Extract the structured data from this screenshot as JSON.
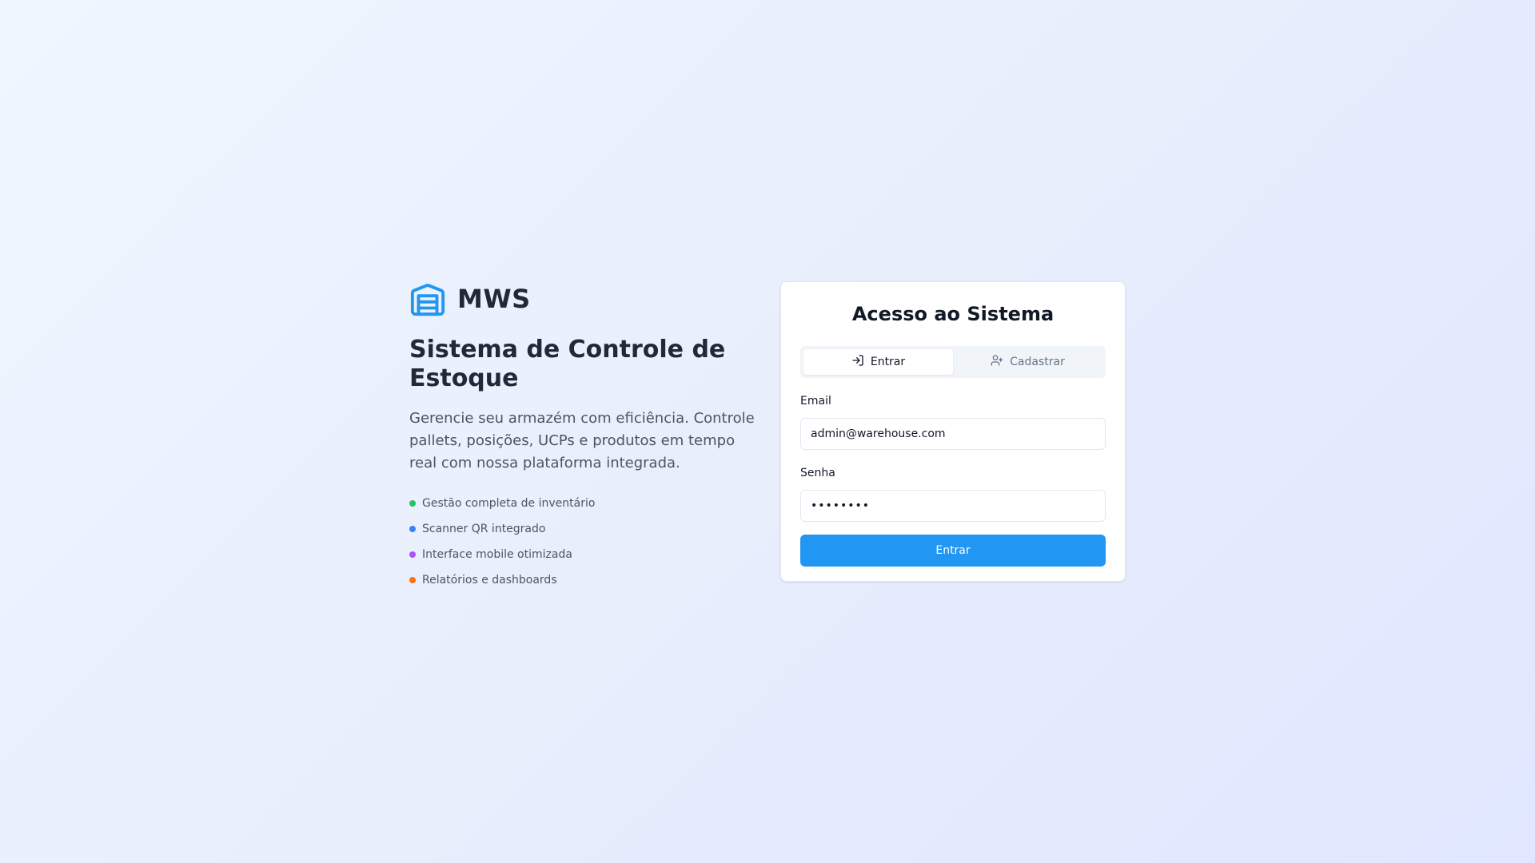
{
  "brand": {
    "name": "MWS",
    "logo_icon": "warehouse-icon",
    "accent_color": "#2196f3"
  },
  "hero": {
    "headline": "Sistema de Controle de Estoque",
    "description": "Gerencie seu armazém com eficiência. Controle pallets, posições, UCPs e produtos em tempo real com nossa plataforma integrada.",
    "features": [
      {
        "label": "Gestão completa de inventário",
        "color": "#22c55e"
      },
      {
        "label": "Scanner QR integrado",
        "color": "#3b82f6"
      },
      {
        "label": "Interface mobile otimizada",
        "color": "#a855f7"
      },
      {
        "label": "Relatórios e dashboards",
        "color": "#f97316"
      }
    ]
  },
  "login_card": {
    "title": "Acesso ao Sistema",
    "tabs": [
      {
        "label": "Entrar",
        "icon": "log-in-icon",
        "active": true
      },
      {
        "label": "Cadastrar",
        "icon": "user-plus-icon",
        "active": false
      }
    ],
    "email": {
      "label": "Email",
      "value": "admin@warehouse.com"
    },
    "password": {
      "label": "Senha",
      "value": "••••••••"
    },
    "submit_label": "Entrar"
  }
}
